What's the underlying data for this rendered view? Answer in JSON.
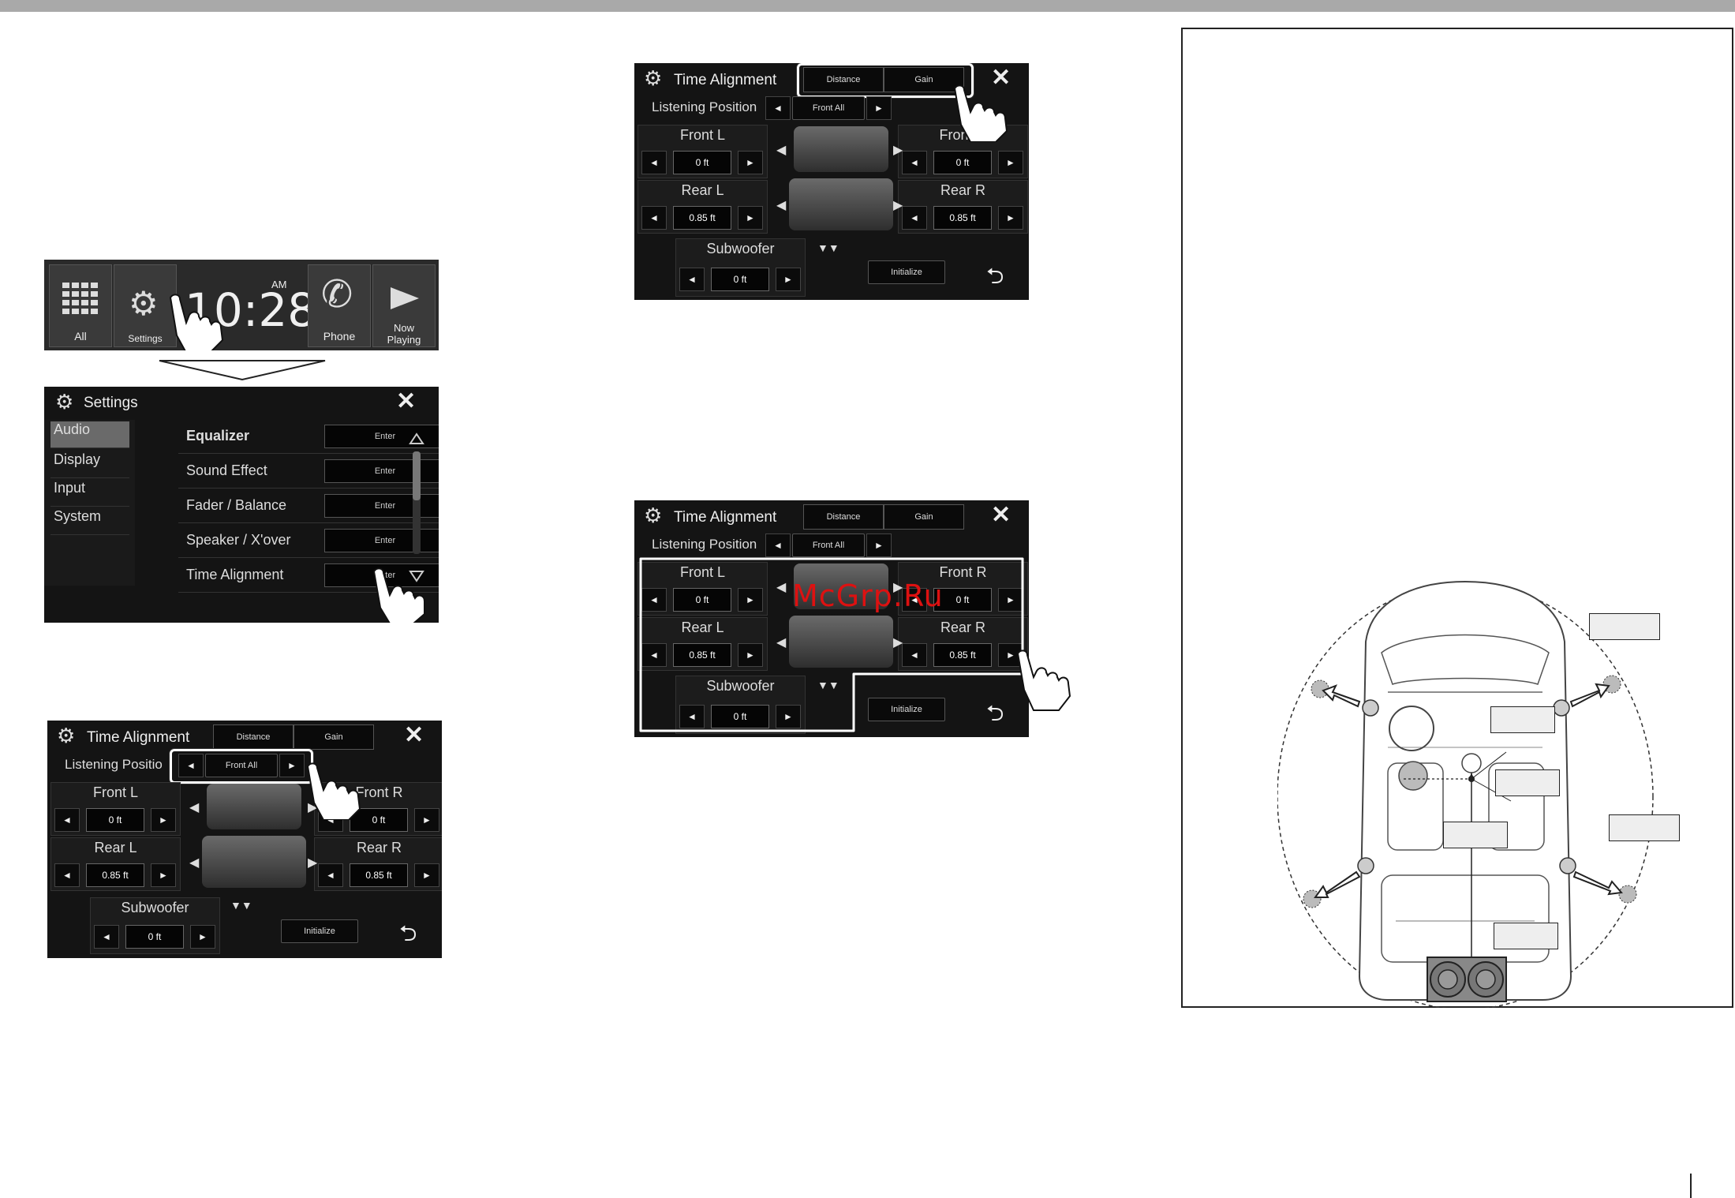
{
  "home_bar": {
    "all_label": "All",
    "settings_label": "Settings",
    "time": "10:28",
    "ampm": "AM",
    "phone_label": "Phone",
    "now_playing_line1": "Now",
    "now_playing_line2": "Playing"
  },
  "settings": {
    "title": "Settings",
    "sidebar": [
      "Audio",
      "Display",
      "Input",
      "System"
    ],
    "rows": [
      {
        "label": "Equalizer",
        "button": "Enter"
      },
      {
        "label": "Sound Effect",
        "button": "Enter"
      },
      {
        "label": "Fader / Balance",
        "button": "Enter"
      },
      {
        "label": "Speaker / X'over",
        "button": "Enter"
      },
      {
        "label": "Time Alignment",
        "button": "Enter"
      }
    ]
  },
  "time_alignment": {
    "title": "Time Alignment",
    "tab_distance": "Distance",
    "tab_gain": "Gain",
    "listening_label": "Listening Position",
    "listening_label_cropped": "Listening Positio",
    "listening_value": "Front All",
    "front_l": "Front L",
    "front_r": "Front R",
    "front_r_cropped": "Front R",
    "rear_l": "Rear L",
    "rear_r": "Rear R",
    "subwoofer": "Subwoofer",
    "initialize": "Initialize",
    "front_value": "0 ft",
    "rear_value": "0.85 ft",
    "sub_value": "0 ft",
    "arrow_left": "◄",
    "arrow_right": "►"
  },
  "watermark": "McGrp.Ru",
  "icons": {
    "gear": "gear-icon",
    "close": "close-icon",
    "back": "back-arrow-icon",
    "hand": "pointing-hand-icon",
    "grid": "grid-icon",
    "phone": "phone-icon",
    "play": "play-icon",
    "speaker": "speaker-icon"
  }
}
